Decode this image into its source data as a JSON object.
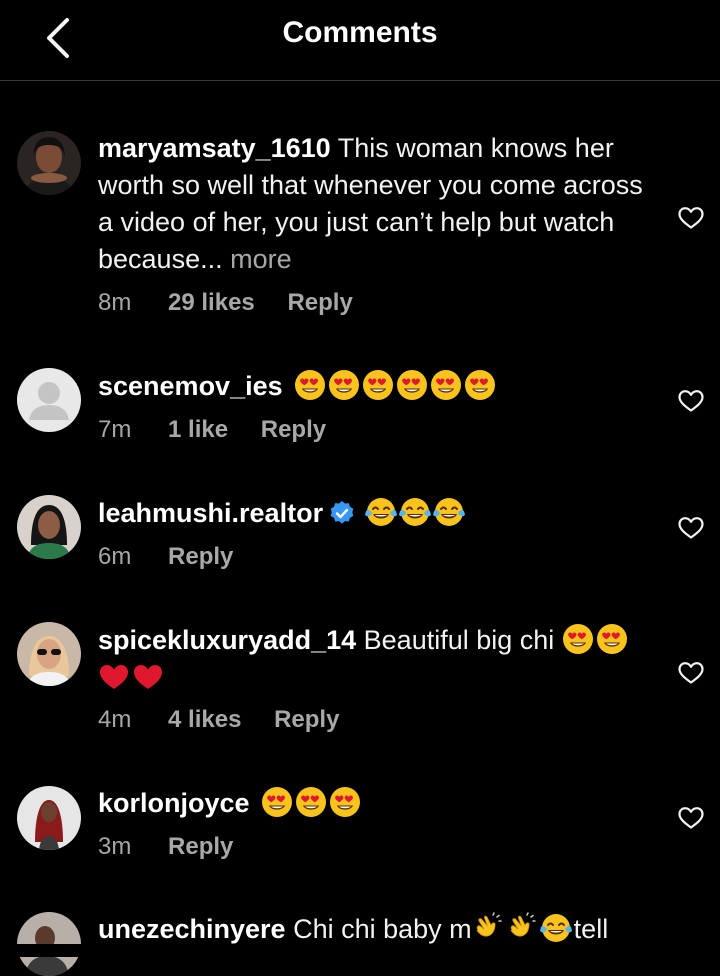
{
  "header": {
    "title": "Comments",
    "back_icon": "chevron-left-icon"
  },
  "comments": [
    {
      "username": "maryamsaty_1610",
      "text": "This woman knows her worth so well that whenever you come across a video of her, you just can’t help but watch because...",
      "more": "more",
      "time": "8m",
      "likes": "29 likes",
      "reply": "Reply"
    },
    {
      "username": "scenemov_ies",
      "text": "",
      "emojis": [
        "heart-eyes",
        "heart-eyes",
        "heart-eyes",
        "heart-eyes",
        "heart-eyes",
        "heart-eyes"
      ],
      "time": "7m",
      "likes": "1 like",
      "reply": "Reply"
    },
    {
      "username": "leahmushi.realtor",
      "verified": true,
      "emojis": [
        "tears-of-joy",
        "tears-of-joy",
        "tears-of-joy"
      ],
      "time": "6m",
      "reply": "Reply"
    },
    {
      "username": "spicekluxuryadd_14",
      "text": "Beautiful big chi",
      "emojis": [
        "heart-eyes",
        "heart-eyes",
        "red-heart",
        "red-heart"
      ],
      "time": "4m",
      "likes": "4 likes",
      "reply": "Reply"
    },
    {
      "username": "korlonjoyce",
      "emojis": [
        "heart-eyes",
        "heart-eyes",
        "heart-eyes"
      ],
      "time": "3m",
      "reply": "Reply"
    },
    {
      "username": "unezechinyere",
      "text": "Chi chi baby m",
      "text_after": "tell",
      "emojis": [
        "clapping-hands",
        "clapping-hands",
        "tears-of-joy"
      ]
    }
  ],
  "colors": {
    "background": "#000000",
    "primary_text": "#f5f5f5",
    "secondary_text": "#a8a8a8",
    "verified_badge": "#3897f0",
    "emoji_yellow": "#f7c31c",
    "heart_red": "#e0182d"
  },
  "icons": {
    "like": "heart-outline-icon",
    "verified": "verified-badge-icon"
  }
}
